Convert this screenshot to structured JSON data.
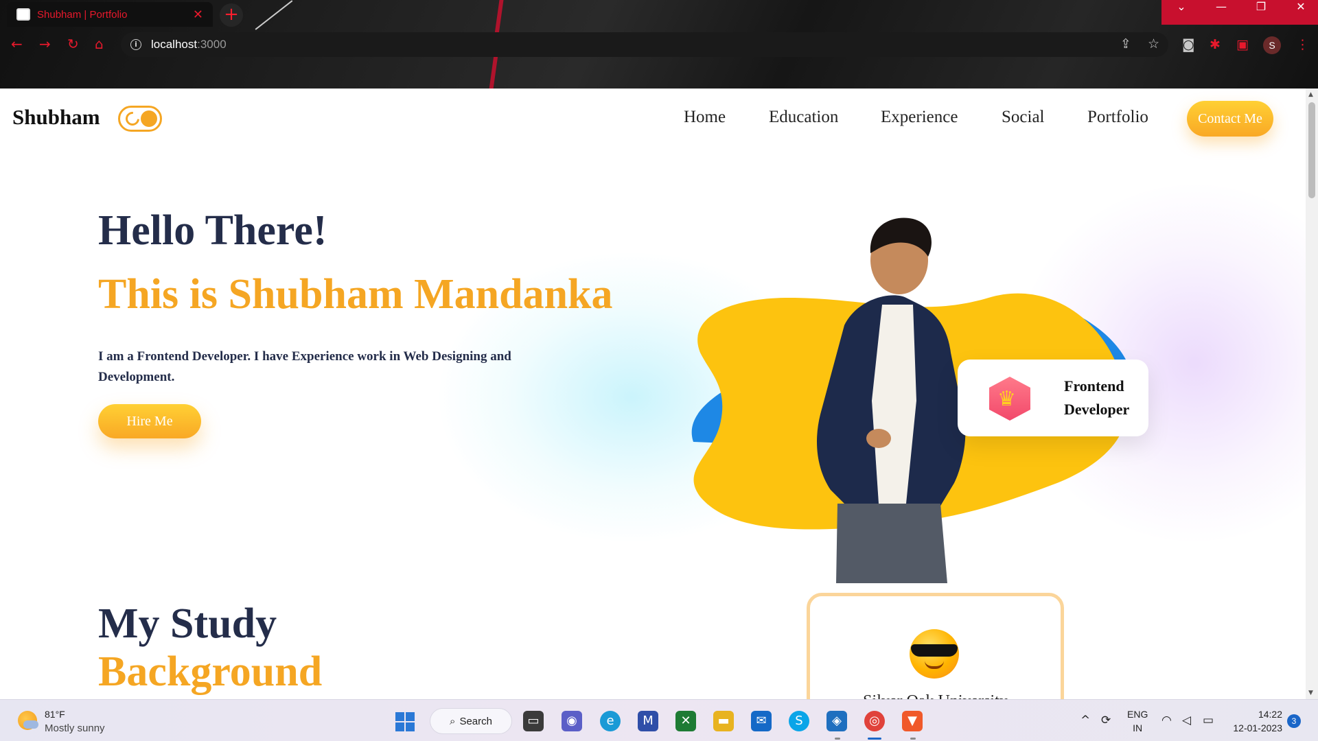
{
  "browser": {
    "tab_title": "Shubham | Portfolio",
    "url_host": "localhost",
    "url_port": ":3000",
    "profile_initial": "S"
  },
  "site": {
    "logo": "Shubham",
    "nav": [
      "Home",
      "Education",
      "Experience",
      "Social",
      "Portfolio"
    ],
    "contact_label": "Contact Me",
    "accent_color": "#f5a623",
    "heading_color": "#242d4a"
  },
  "hero": {
    "greeting": "Hello There!",
    "name_line": "This is Shubham Mandanka",
    "description": "I am a Frontend Developer. I have Experience work in Web Designing and Development.",
    "cta": "Hire Me",
    "badge": {
      "line1": "Frontend",
      "line2": "Developer",
      "icon": "crown-icon"
    }
  },
  "study": {
    "title": "My Study",
    "subtitle": "Background",
    "card_text": "Silver Oak University",
    "card_icon": "sunglasses-emoji-icon"
  },
  "taskbar": {
    "temperature": "81°F",
    "condition": "Mostly sunny",
    "search_label": "Search",
    "lang_top": "ENG",
    "lang_bottom": "IN",
    "time": "14:22",
    "date": "12-01-2023",
    "notifications": "3",
    "chrome_badge": "S"
  }
}
